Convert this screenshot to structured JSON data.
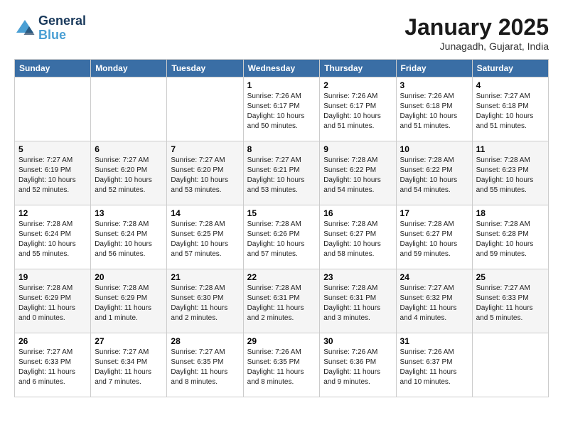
{
  "header": {
    "logo_line1": "General",
    "logo_line2": "Blue",
    "month_title": "January 2025",
    "location": "Junagadh, Gujarat, India"
  },
  "weekdays": [
    "Sunday",
    "Monday",
    "Tuesday",
    "Wednesday",
    "Thursday",
    "Friday",
    "Saturday"
  ],
  "weeks": [
    [
      {
        "day": "",
        "info": ""
      },
      {
        "day": "",
        "info": ""
      },
      {
        "day": "",
        "info": ""
      },
      {
        "day": "1",
        "info": "Sunrise: 7:26 AM\nSunset: 6:17 PM\nDaylight: 10 hours\nand 50 minutes."
      },
      {
        "day": "2",
        "info": "Sunrise: 7:26 AM\nSunset: 6:17 PM\nDaylight: 10 hours\nand 51 minutes."
      },
      {
        "day": "3",
        "info": "Sunrise: 7:26 AM\nSunset: 6:18 PM\nDaylight: 10 hours\nand 51 minutes."
      },
      {
        "day": "4",
        "info": "Sunrise: 7:27 AM\nSunset: 6:18 PM\nDaylight: 10 hours\nand 51 minutes."
      }
    ],
    [
      {
        "day": "5",
        "info": "Sunrise: 7:27 AM\nSunset: 6:19 PM\nDaylight: 10 hours\nand 52 minutes."
      },
      {
        "day": "6",
        "info": "Sunrise: 7:27 AM\nSunset: 6:20 PM\nDaylight: 10 hours\nand 52 minutes."
      },
      {
        "day": "7",
        "info": "Sunrise: 7:27 AM\nSunset: 6:20 PM\nDaylight: 10 hours\nand 53 minutes."
      },
      {
        "day": "8",
        "info": "Sunrise: 7:27 AM\nSunset: 6:21 PM\nDaylight: 10 hours\nand 53 minutes."
      },
      {
        "day": "9",
        "info": "Sunrise: 7:28 AM\nSunset: 6:22 PM\nDaylight: 10 hours\nand 54 minutes."
      },
      {
        "day": "10",
        "info": "Sunrise: 7:28 AM\nSunset: 6:22 PM\nDaylight: 10 hours\nand 54 minutes."
      },
      {
        "day": "11",
        "info": "Sunrise: 7:28 AM\nSunset: 6:23 PM\nDaylight: 10 hours\nand 55 minutes."
      }
    ],
    [
      {
        "day": "12",
        "info": "Sunrise: 7:28 AM\nSunset: 6:24 PM\nDaylight: 10 hours\nand 55 minutes."
      },
      {
        "day": "13",
        "info": "Sunrise: 7:28 AM\nSunset: 6:24 PM\nDaylight: 10 hours\nand 56 minutes."
      },
      {
        "day": "14",
        "info": "Sunrise: 7:28 AM\nSunset: 6:25 PM\nDaylight: 10 hours\nand 57 minutes."
      },
      {
        "day": "15",
        "info": "Sunrise: 7:28 AM\nSunset: 6:26 PM\nDaylight: 10 hours\nand 57 minutes."
      },
      {
        "day": "16",
        "info": "Sunrise: 7:28 AM\nSunset: 6:27 PM\nDaylight: 10 hours\nand 58 minutes."
      },
      {
        "day": "17",
        "info": "Sunrise: 7:28 AM\nSunset: 6:27 PM\nDaylight: 10 hours\nand 59 minutes."
      },
      {
        "day": "18",
        "info": "Sunrise: 7:28 AM\nSunset: 6:28 PM\nDaylight: 10 hours\nand 59 minutes."
      }
    ],
    [
      {
        "day": "19",
        "info": "Sunrise: 7:28 AM\nSunset: 6:29 PM\nDaylight: 11 hours\nand 0 minutes."
      },
      {
        "day": "20",
        "info": "Sunrise: 7:28 AM\nSunset: 6:29 PM\nDaylight: 11 hours\nand 1 minute."
      },
      {
        "day": "21",
        "info": "Sunrise: 7:28 AM\nSunset: 6:30 PM\nDaylight: 11 hours\nand 2 minutes."
      },
      {
        "day": "22",
        "info": "Sunrise: 7:28 AM\nSunset: 6:31 PM\nDaylight: 11 hours\nand 2 minutes."
      },
      {
        "day": "23",
        "info": "Sunrise: 7:28 AM\nSunset: 6:31 PM\nDaylight: 11 hours\nand 3 minutes."
      },
      {
        "day": "24",
        "info": "Sunrise: 7:27 AM\nSunset: 6:32 PM\nDaylight: 11 hours\nand 4 minutes."
      },
      {
        "day": "25",
        "info": "Sunrise: 7:27 AM\nSunset: 6:33 PM\nDaylight: 11 hours\nand 5 minutes."
      }
    ],
    [
      {
        "day": "26",
        "info": "Sunrise: 7:27 AM\nSunset: 6:33 PM\nDaylight: 11 hours\nand 6 minutes."
      },
      {
        "day": "27",
        "info": "Sunrise: 7:27 AM\nSunset: 6:34 PM\nDaylight: 11 hours\nand 7 minutes."
      },
      {
        "day": "28",
        "info": "Sunrise: 7:27 AM\nSunset: 6:35 PM\nDaylight: 11 hours\nand 8 minutes."
      },
      {
        "day": "29",
        "info": "Sunrise: 7:26 AM\nSunset: 6:35 PM\nDaylight: 11 hours\nand 8 minutes."
      },
      {
        "day": "30",
        "info": "Sunrise: 7:26 AM\nSunset: 6:36 PM\nDaylight: 11 hours\nand 9 minutes."
      },
      {
        "day": "31",
        "info": "Sunrise: 7:26 AM\nSunset: 6:37 PM\nDaylight: 11 hours\nand 10 minutes."
      },
      {
        "day": "",
        "info": ""
      }
    ]
  ]
}
